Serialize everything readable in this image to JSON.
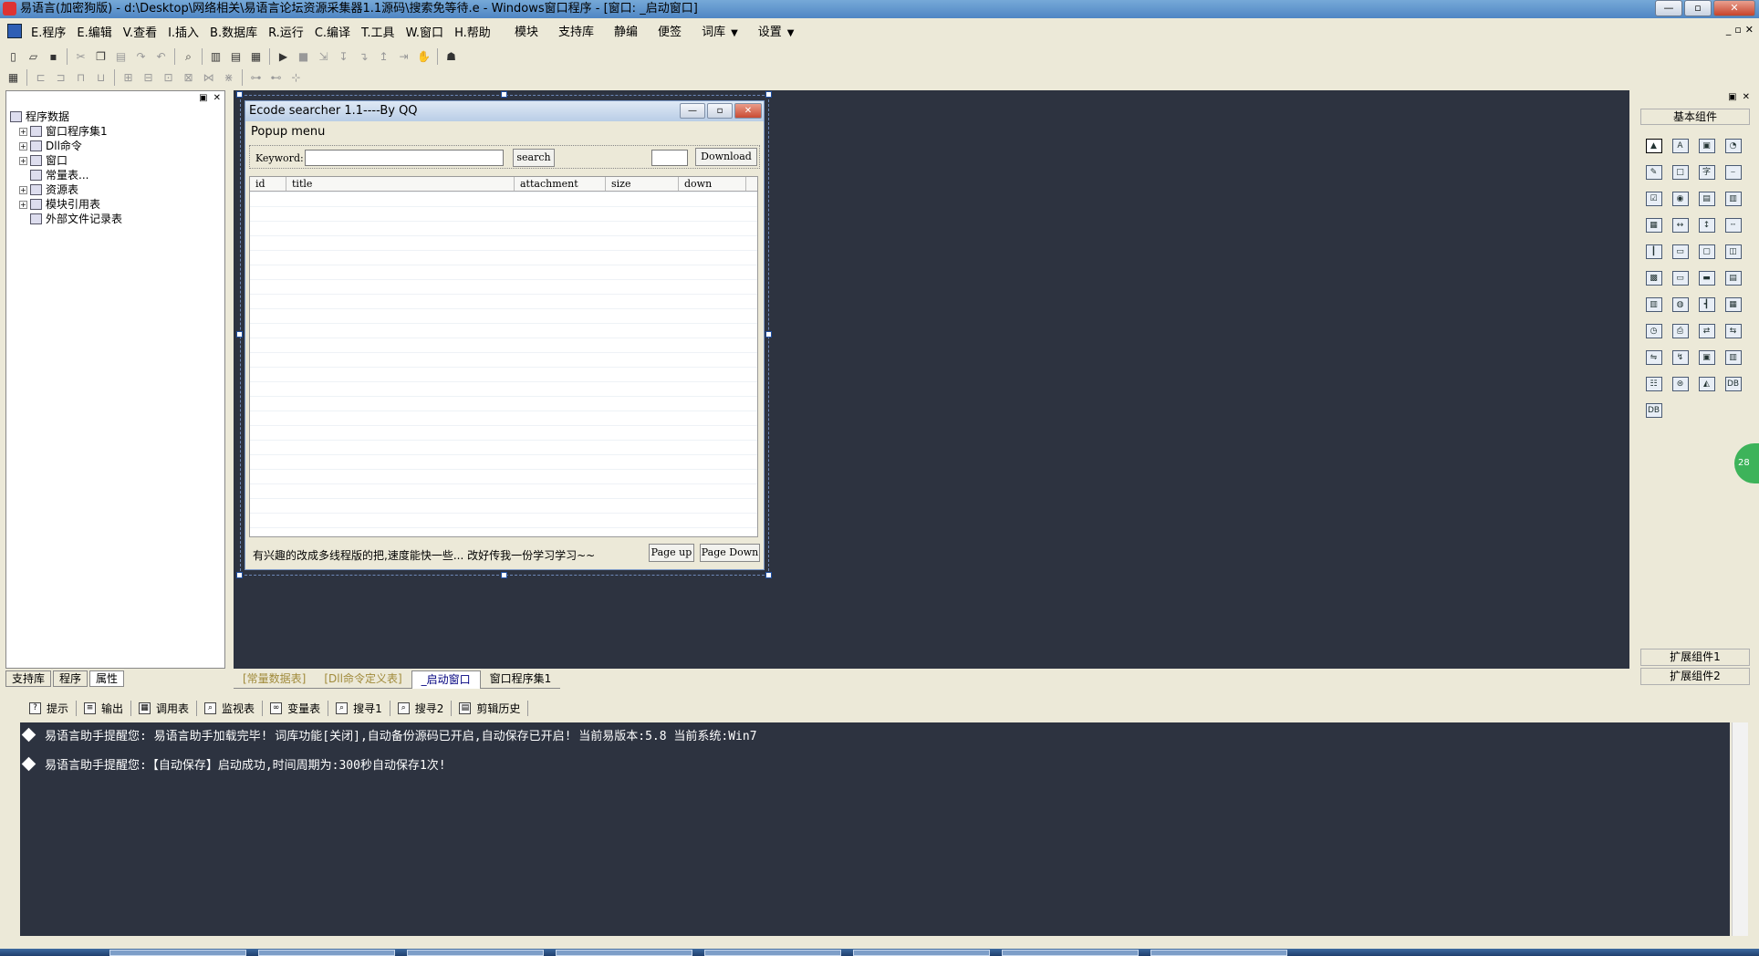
{
  "window": {
    "title": "易语言(加密狗版) - d:\\Desktop\\网络相关\\易语言论坛资源采集器1.1源码\\搜索免等待.e - Windows窗口程序 - [窗口: _启动窗口]"
  },
  "menu": {
    "items": [
      "E.程序",
      "E.编辑",
      "V.查看",
      "I.插入",
      "B.数据库",
      "R.运行",
      "C.编译",
      "T.工具",
      "W.窗口",
      "H.帮助"
    ],
    "right_items": [
      "模块",
      "支持库",
      "静编",
      "便签",
      "词库",
      "设置"
    ]
  },
  "left_panel": {
    "root": "程序数据",
    "children": [
      "窗口程序集1",
      "Dll命令",
      "窗口",
      "常量表...",
      "资源表",
      "模块引用表",
      "外部文件记录表"
    ],
    "tabs": [
      "支持库",
      "程序",
      "属性"
    ]
  },
  "form": {
    "title": "Ecode searcher 1.1----By QQ",
    "popup_menu": "Popup menu",
    "keyword_label": "Keyword:",
    "search_button": "search",
    "download_button": "Download",
    "columns": [
      "id",
      "title",
      "attachment",
      "size",
      "down"
    ],
    "footer_note": "有兴趣的改成多线程版的把,速度能快一些...  改好传我一份学习学习~~",
    "page_up": "Page up",
    "page_down": "Page Down"
  },
  "design_tabs": [
    "[常量数据表]",
    "[Dll命令定义表]",
    "_启动窗口",
    "窗口程序集1"
  ],
  "right_panel": {
    "title": "基本组件",
    "ext1": "扩展组件1",
    "ext2": "扩展组件2",
    "components": [
      "pointer-icon",
      "label-icon",
      "image-box-icon",
      "shape-icon",
      "edit-box-icon",
      "picture-icon",
      "text-icon",
      "line-icon",
      "checkbox-icon",
      "radio-icon",
      "list-icon",
      "combo-icon",
      "grid-icon",
      "scroll-icon",
      "vscroll-icon",
      "divider-icon",
      "ruler-icon",
      "tab-icon",
      "group-icon",
      "window-icon",
      "calendar-icon",
      "input-icon",
      "folder-icon",
      "doc-icon",
      "table-icon",
      "globe-icon",
      "splitter-icon",
      "datagrid-icon",
      "timer-icon",
      "printer-icon",
      "network-icon",
      "client-icon",
      "server-icon",
      "switch-icon",
      "frame-icon",
      "multi-frame-icon",
      "tree-icon",
      "db-icon",
      "chart-icon",
      "odbc-icon",
      "odbc2-icon"
    ],
    "component_labels": [
      "▲",
      "A",
      "▣",
      "◔",
      "✎",
      "□",
      "字",
      "⎯",
      "☑",
      "◉",
      "▤",
      "▥",
      "▦",
      "↔",
      "↕",
      "╌",
      "┃",
      "▭",
      "▢",
      "◫",
      "▩",
      "▭",
      "▬",
      "▤",
      "▥",
      "◍",
      "┫",
      "▦",
      "◷",
      "⎙",
      "⇄",
      "⇆",
      "⇋",
      "↯",
      "▣",
      "▥",
      "☷",
      "⊜",
      "◭",
      "DB",
      "DB"
    ]
  },
  "green_badge": "28",
  "bottom_tabs": [
    {
      "label": "提示",
      "icon": "hint-icon"
    },
    {
      "label": "输出",
      "icon": "output-icon"
    },
    {
      "label": "调用表",
      "icon": "call-table-icon"
    },
    {
      "label": "监视表",
      "icon": "watch-icon"
    },
    {
      "label": "变量表",
      "icon": "variable-icon"
    },
    {
      "label": "搜寻1",
      "icon": "search1-icon"
    },
    {
      "label": "搜寻2",
      "icon": "search2-icon"
    },
    {
      "label": "剪辑历史",
      "icon": "clip-history-icon"
    }
  ],
  "output": {
    "lines": [
      "易语言助手提醒您:  易语言助手加载完毕!  词库功能[关闭],自动备份源码已开启,自动保存已开启!  当前易版本:5.8  当前系统:Win7",
      "易语言助手提醒您:【自动保存】启动成功,时间周期为:300秒自动保存1次!"
    ]
  }
}
